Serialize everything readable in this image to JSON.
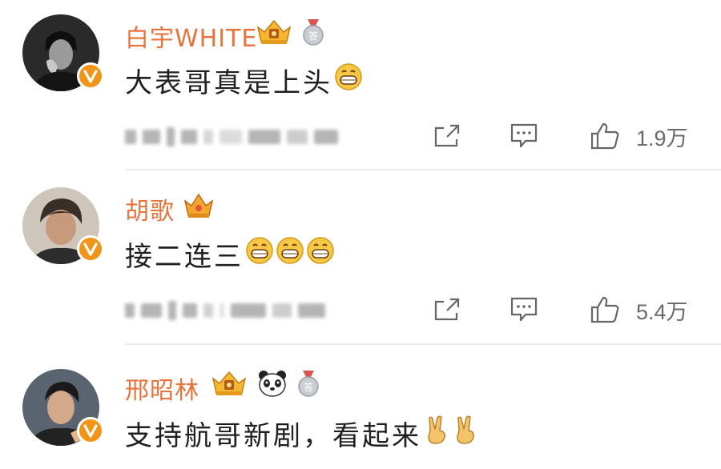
{
  "comments": [
    {
      "username": "白宇WHITE",
      "text": "大表哥真是上头",
      "likes": "1.9万",
      "badges": [
        "crown-badge",
        "medal-badge"
      ],
      "emojis": [
        "grin-emoji"
      ]
    },
    {
      "username": "胡歌",
      "text": "接二连三",
      "likes": "5.4万",
      "badges": [
        "crown-badge"
      ],
      "emojis": [
        "grin-emoji",
        "grin-emoji",
        "grin-emoji"
      ]
    },
    {
      "username": "邢昭林",
      "text": "支持航哥新剧，看起来",
      "badges": [
        "crown-badge",
        "panda-badge",
        "medal-badge"
      ],
      "emojis": [
        "victory-hand-emoji",
        "victory-hand-emoji"
      ]
    }
  ],
  "colors": {
    "username": "#e8743b",
    "verified_badge": "#f29418",
    "text": "#1f1f1f",
    "meta": "#6b6b6b",
    "divider": "#ececec"
  }
}
